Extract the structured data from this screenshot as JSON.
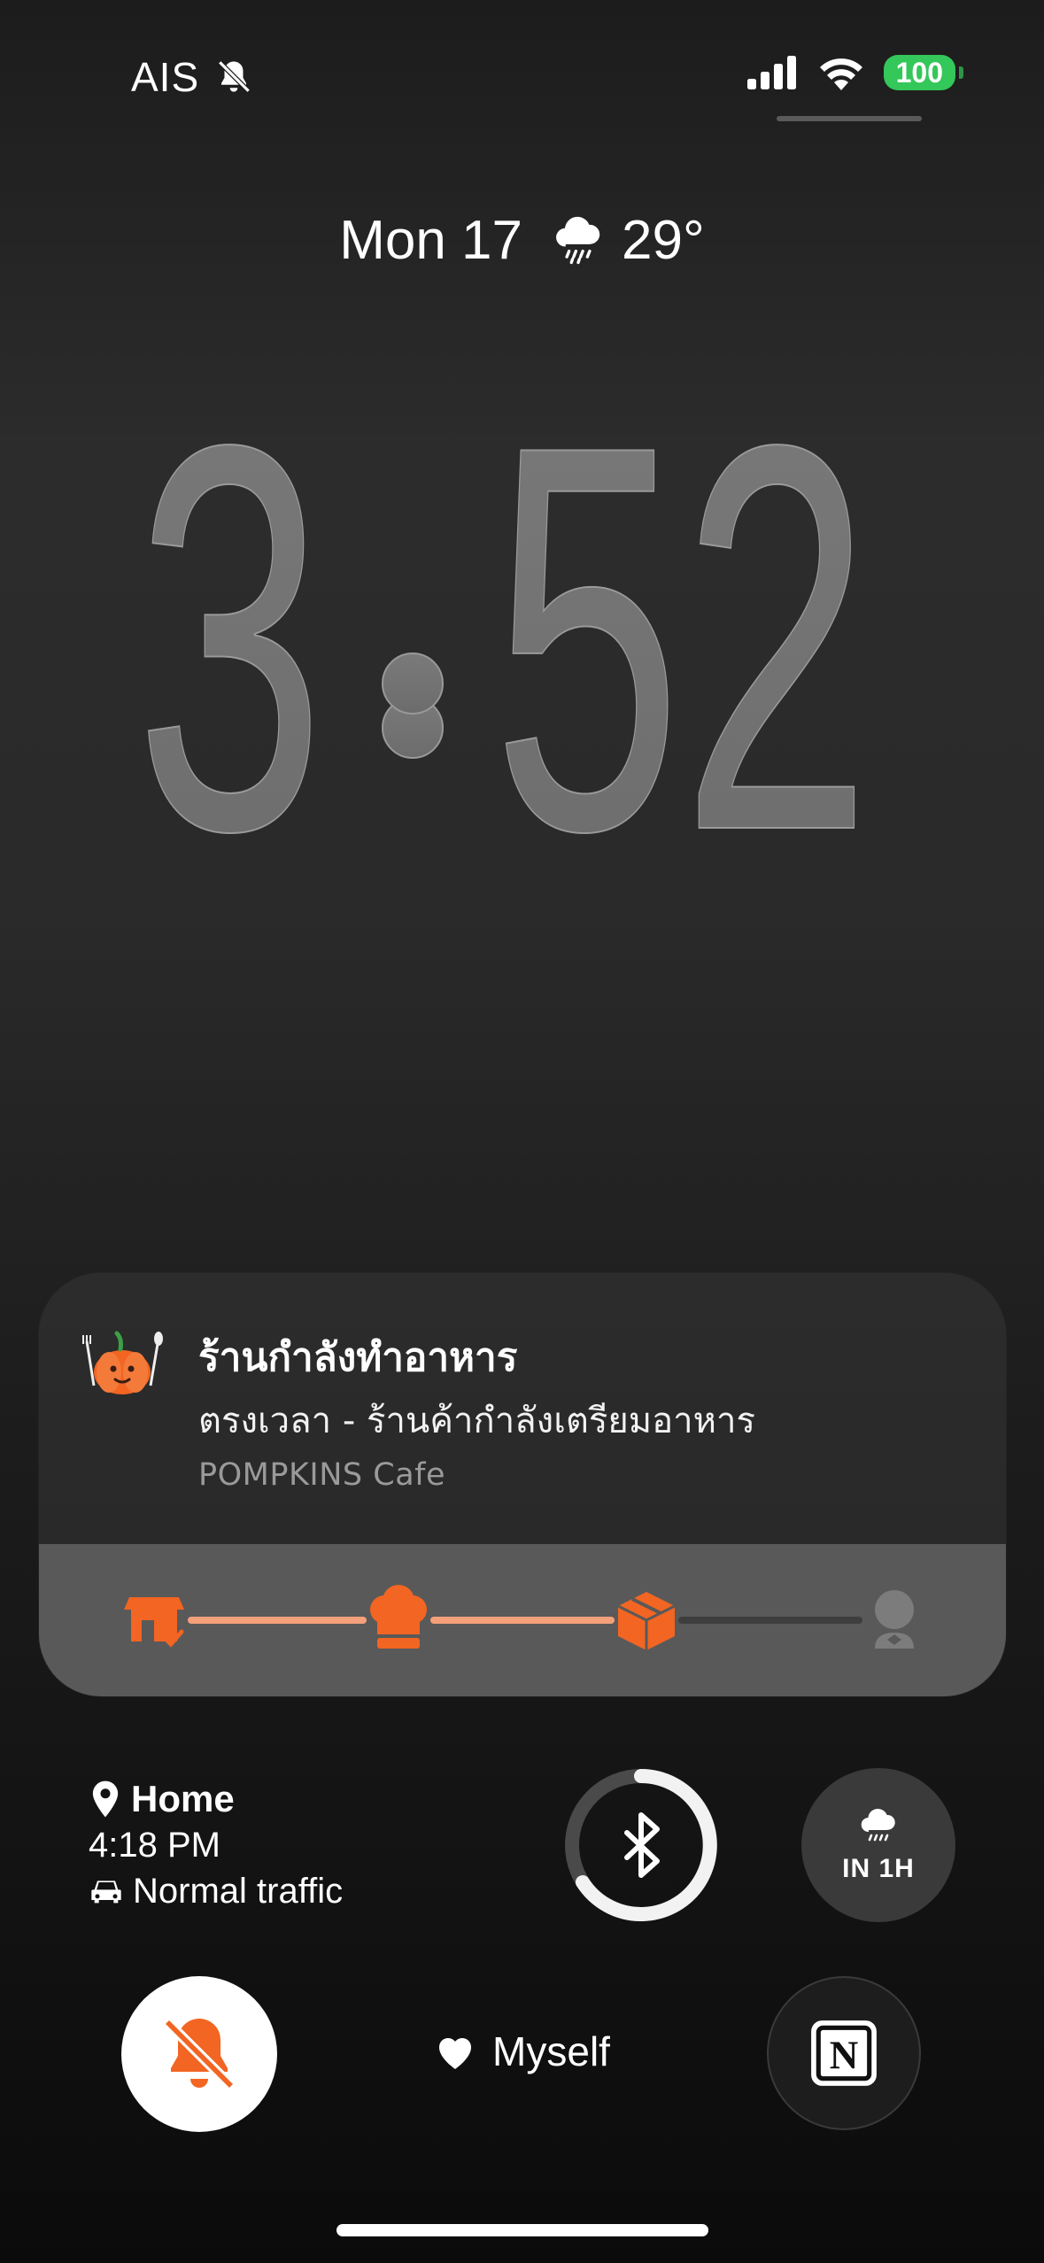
{
  "status_bar": {
    "carrier": "AIS",
    "battery": "100",
    "icons": [
      "bell-slash-icon",
      "cellular-signal-icon",
      "wifi-icon",
      "battery-icon"
    ]
  },
  "lockscreen": {
    "date": "Mon 17",
    "temperature": "29°",
    "weather_icon": "cloud-rain-icon",
    "time_hour": "3",
    "time_minutes": "52"
  },
  "live_activity": {
    "title": "ร้านกำลังทำอาหาร",
    "subtitle": "ตรงเวลา - ร้านค้ากำลังเตรียมอาหาร",
    "store": "POMPKINS Cafe",
    "progress_steps": [
      "store-check-icon",
      "chef-hat-icon",
      "package-icon",
      "delivery-person-icon"
    ],
    "active_steps": 3,
    "accent_color": "#f26522"
  },
  "widgets": {
    "location": {
      "destination": "Home",
      "eta": "4:18 PM",
      "traffic": "Normal traffic"
    },
    "bluetooth": {
      "icon": "bluetooth-icon"
    },
    "rain": {
      "label": "IN 1H",
      "icon": "cloud-rain-icon"
    }
  },
  "bottom": {
    "focus_label": "Myself",
    "focus_icon": "heart-icon",
    "left_button_icon": "bell-slash-icon",
    "right_button_icon": "notion-icon"
  }
}
